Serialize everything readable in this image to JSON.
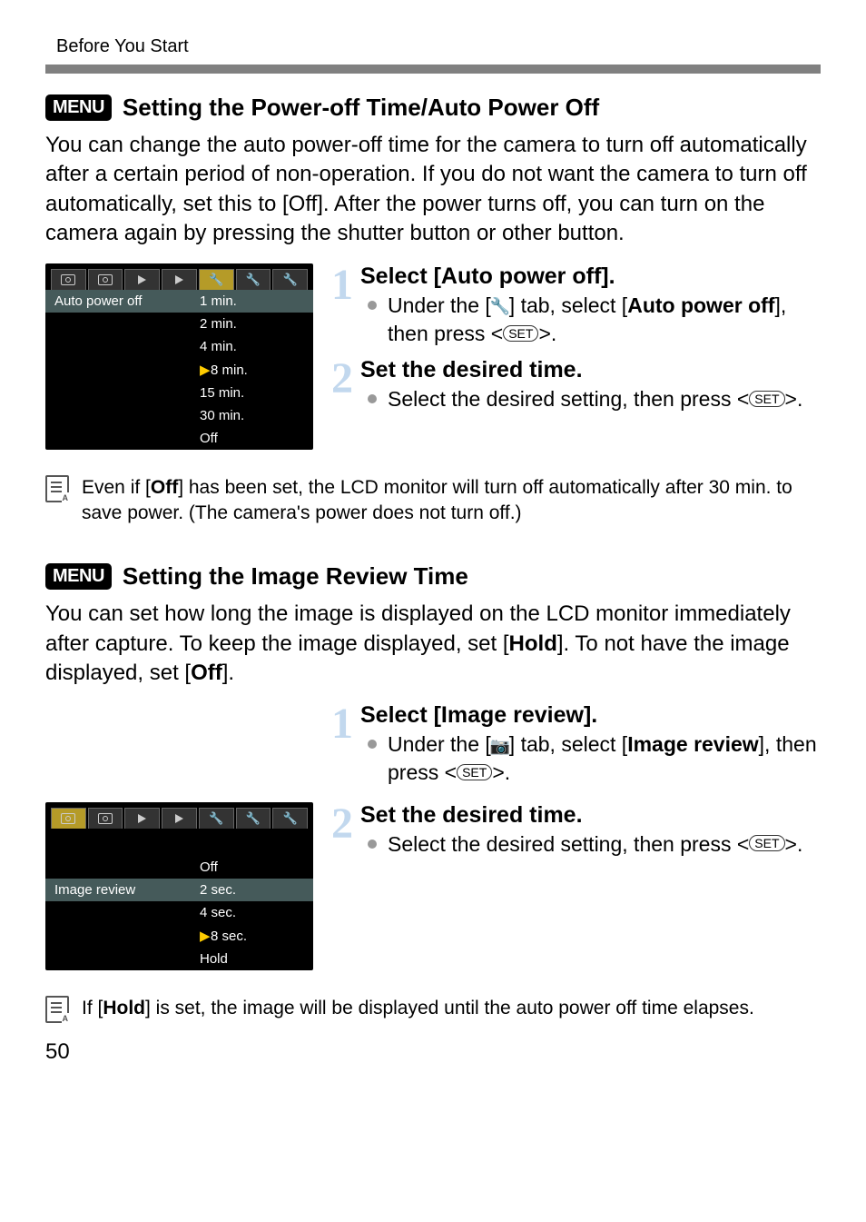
{
  "breadcrumb": "Before You Start",
  "menu_badge": "MENU",
  "section1": {
    "title": "Setting the Power-off Time/Auto Power Off",
    "intro": "You can change the auto power-off time for the camera to turn off automatically after a certain period of non-operation. If you do not want the camera to turn off automatically, set this to [Off]. After the power turns off, you can turn on the camera again by pressing the shutter button or other button.",
    "screenshot": {
      "label": "Auto power off",
      "options": [
        "1 min.",
        "2 min.",
        "4 min.",
        "8 min.",
        "15 min.",
        "30 min.",
        "Off"
      ],
      "selected_index": 3
    },
    "step1_title": "Select [Auto power off].",
    "step1_text_a": "Under the [",
    "step1_text_b": "] tab, select [",
    "step1_bold": "Auto power off",
    "step1_text_c": "], then press <",
    "step1_set": "SET",
    "step1_text_d": ">.",
    "step2_title": "Set the desired time.",
    "step2_text_a": "Select the desired setting, then press <",
    "step2_set": "SET",
    "step2_text_b": ">.",
    "note_a": "Even if [",
    "note_bold": "Off",
    "note_b": "] has been set, the LCD monitor will turn off automatically after 30 min. to save power. (The camera's power does not turn off.)"
  },
  "section2": {
    "title": "Setting the Image Review Time",
    "intro_a": "You can set how long the image is displayed on the LCD monitor immediately after capture. To keep the image displayed, set [",
    "intro_bold1": "Hold",
    "intro_b": "]. To not have the image displayed, set [",
    "intro_bold2": "Off",
    "intro_c": "].",
    "screenshot": {
      "label": "Image review",
      "options": [
        "Off",
        "2 sec.",
        "4 sec.",
        "8 sec.",
        "Hold"
      ],
      "selected_index": 3
    },
    "step1_title": "Select [Image review].",
    "step1_text_a": "Under the [",
    "step1_text_b": "] tab, select [",
    "step1_bold": "Image review",
    "step1_text_c": "], then press <",
    "step1_set": "SET",
    "step1_text_d": ">.",
    "step2_title": "Set the desired time.",
    "step2_text_a": "Select the desired setting, then press <",
    "step2_set": "SET",
    "step2_text_b": ">.",
    "note_a": "If [",
    "note_bold": "Hold",
    "note_b": "] is set, the image will be displayed until the auto power off time elapses."
  },
  "page_number": "50"
}
